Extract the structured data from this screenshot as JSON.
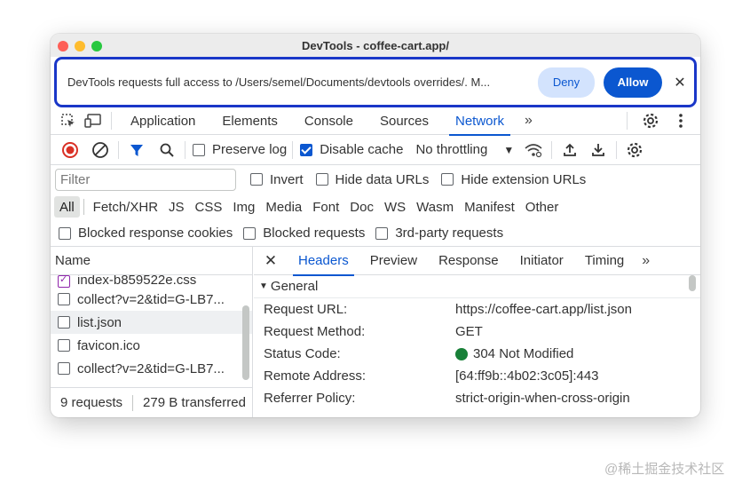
{
  "window": {
    "title": "DevTools - coffee-cart.app/"
  },
  "infobar": {
    "message": "DevTools requests full access to /Users/semel/Documents/devtools overrides/. M...",
    "deny_label": "Deny",
    "allow_label": "Allow",
    "close_icon": "close-icon"
  },
  "tabs": {
    "items": [
      {
        "label": "Application",
        "active": false
      },
      {
        "label": "Elements",
        "active": false
      },
      {
        "label": "Console",
        "active": false
      },
      {
        "label": "Sources",
        "active": false
      },
      {
        "label": "Network",
        "active": true
      }
    ]
  },
  "toolbar": {
    "preserve_log": "Preserve log",
    "preserve_log_checked": false,
    "disable_cache": "Disable cache",
    "disable_cache_checked": true,
    "throttling": "No throttling"
  },
  "filter": {
    "placeholder": "Filter",
    "invert": "Invert",
    "hide_data_urls": "Hide data URLs",
    "hide_extension_urls": "Hide extension URLs"
  },
  "types": [
    "All",
    "Fetch/XHR",
    "JS",
    "CSS",
    "Img",
    "Media",
    "Font",
    "Doc",
    "WS",
    "Wasm",
    "Manifest",
    "Other"
  ],
  "blocked": {
    "blocked_response_cookies": "Blocked response cookies",
    "blocked_requests": "Blocked requests",
    "third_party": "3rd-party requests"
  },
  "requests": {
    "header": "Name",
    "items": [
      {
        "name": "index-b859522e.css"
      },
      {
        "name": "collect?v=2&tid=G-LB7..."
      },
      {
        "name": "list.json"
      },
      {
        "name": "favicon.ico"
      },
      {
        "name": "collect?v=2&tid=G-LB7..."
      }
    ],
    "summary_count": "9 requests",
    "summary_transferred": "279 B transferred"
  },
  "details": {
    "tabs": [
      "Headers",
      "Preview",
      "Response",
      "Initiator",
      "Timing"
    ],
    "active_tab": "Headers",
    "section": "General",
    "rows": [
      {
        "key": "Request URL:",
        "value": "https://coffee-cart.app/list.json"
      },
      {
        "key": "Request Method:",
        "value": "GET"
      },
      {
        "key": "Status Code:",
        "value": "304 Not Modified"
      },
      {
        "key": "Remote Address:",
        "value": "[64:ff9b::4b02:3c05]:443"
      },
      {
        "key": "Referrer Policy:",
        "value": "strict-origin-when-cross-origin"
      }
    ]
  },
  "watermark": "@稀土掘金技术社区",
  "colors": {
    "accent": "#0b57d0",
    "highlight_border": "#1a37c8",
    "status_ok": "#188038"
  }
}
